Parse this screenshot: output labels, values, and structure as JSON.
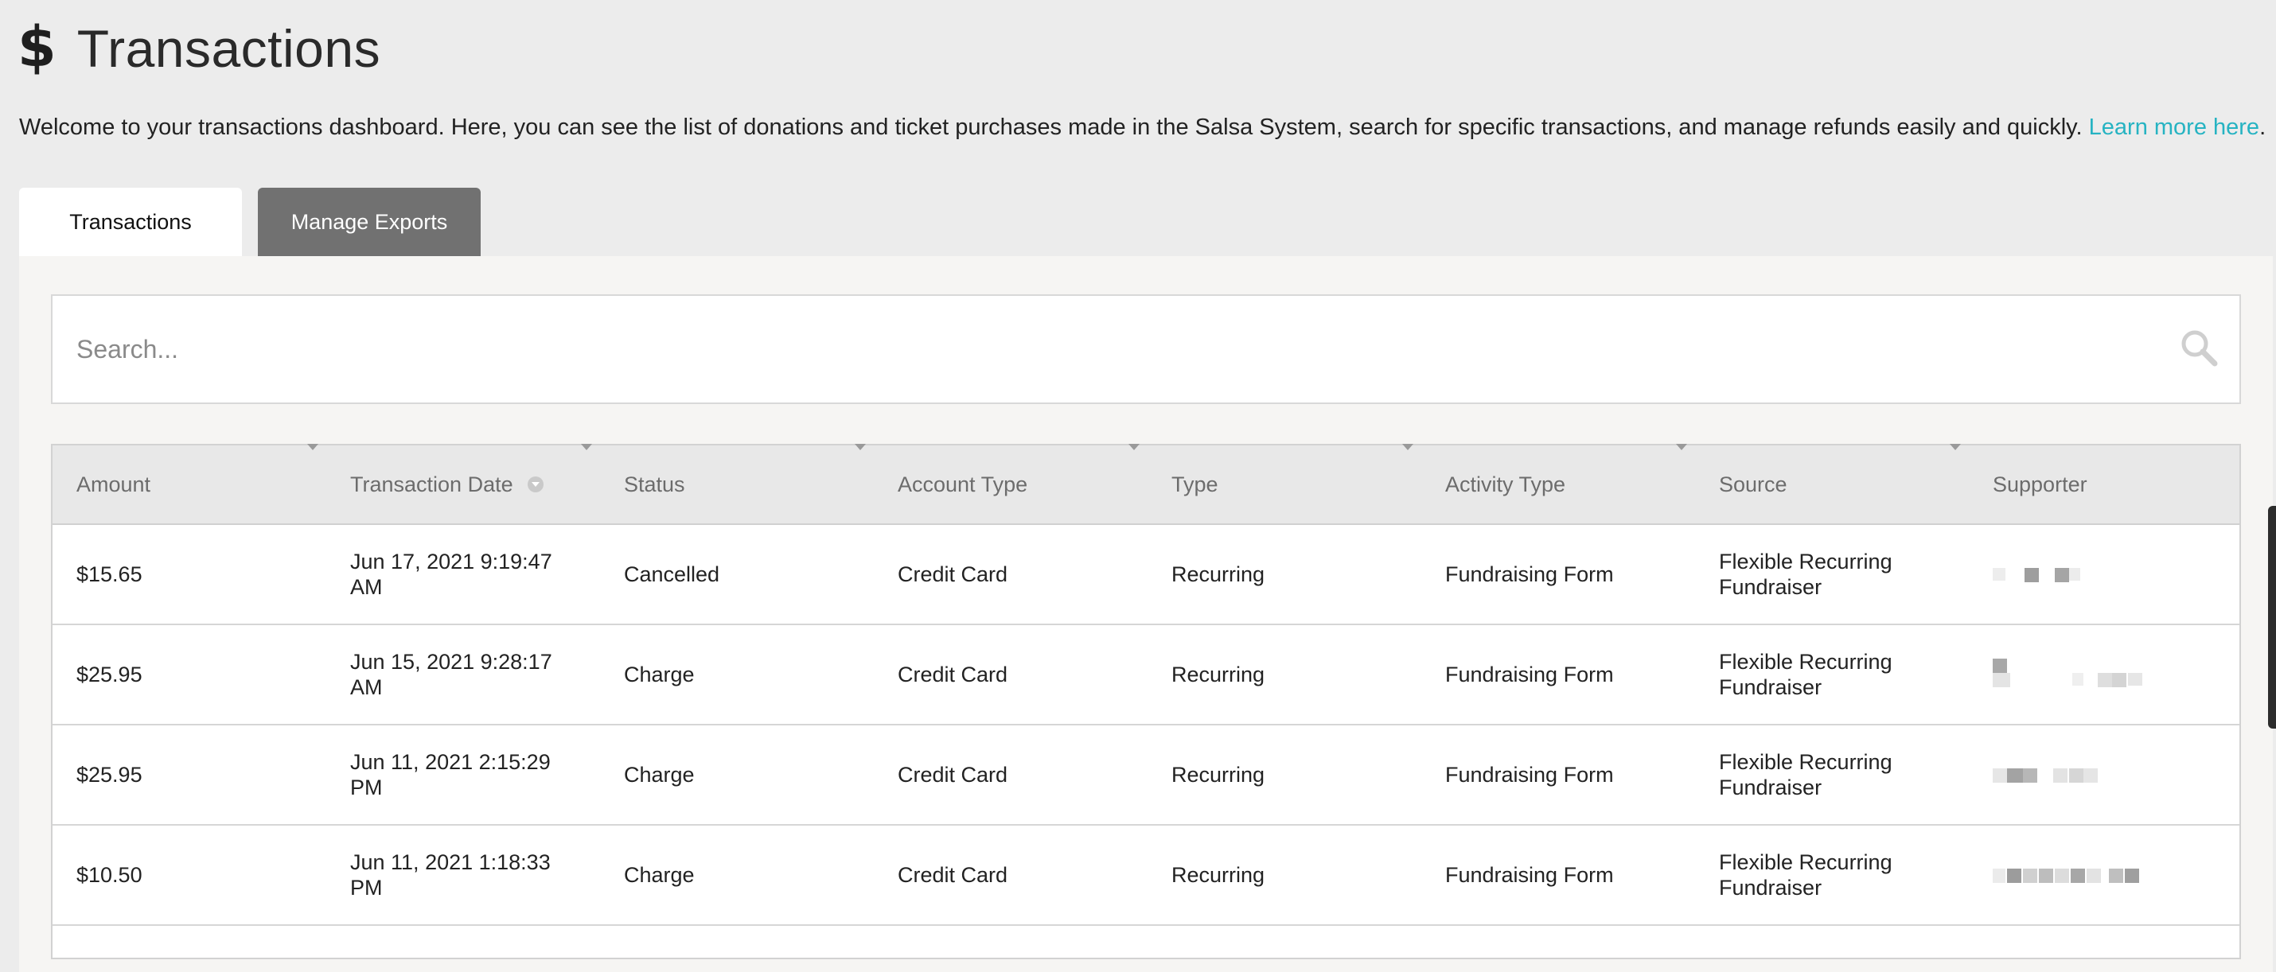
{
  "header": {
    "icon": "dollar-icon",
    "title": "Transactions"
  },
  "intro": {
    "text": "Welcome to your transactions dashboard. Here, you can see the list of donations and ticket purchases made in the Salsa System, search for specific transactions, and manage refunds easily and quickly.",
    "link_label": "Learn more here",
    "trailing": "."
  },
  "tabs": [
    {
      "label": "Transactions",
      "active": true
    },
    {
      "label": "Manage Exports",
      "active": false
    }
  ],
  "search": {
    "placeholder": "Search...",
    "value": ""
  },
  "table": {
    "columns": [
      "Amount",
      "Transaction Date",
      "Status",
      "Account Type",
      "Type",
      "Activity Type",
      "Source",
      "Supporter"
    ],
    "rows": [
      {
        "amount": "$15.65",
        "date": "Jun 17, 2021 9:19:47 AM",
        "status": "Cancelled",
        "account_type": "Credit Card",
        "type": "Recurring",
        "activity_type": "Fundraising Form",
        "source": "Flexible Recurring Fundraiser",
        "supporter": "[redacted]"
      },
      {
        "amount": "$25.95",
        "date": "Jun 15, 2021 9:28:17 AM",
        "status": "Charge",
        "account_type": "Credit Card",
        "type": "Recurring",
        "activity_type": "Fundraising Form",
        "source": "Flexible Recurring Fundraiser",
        "supporter": "[redacted]"
      },
      {
        "amount": "$25.95",
        "date": "Jun 11, 2021 2:15:29 PM",
        "status": "Charge",
        "account_type": "Credit Card",
        "type": "Recurring",
        "activity_type": "Fundraising Form",
        "source": "Flexible Recurring Fundraiser",
        "supporter": "[redacted]"
      },
      {
        "amount": "$10.50",
        "date": "Jun 11, 2021 1:18:33 PM",
        "status": "Charge",
        "account_type": "Credit Card",
        "type": "Recurring",
        "activity_type": "Fundraising Form",
        "source": "Flexible Recurring Fundraiser",
        "supporter": "[redacted]"
      }
    ]
  },
  "colors": {
    "background": "#ececec",
    "link": "#26b3c2",
    "inactive_tab": "#717171"
  }
}
